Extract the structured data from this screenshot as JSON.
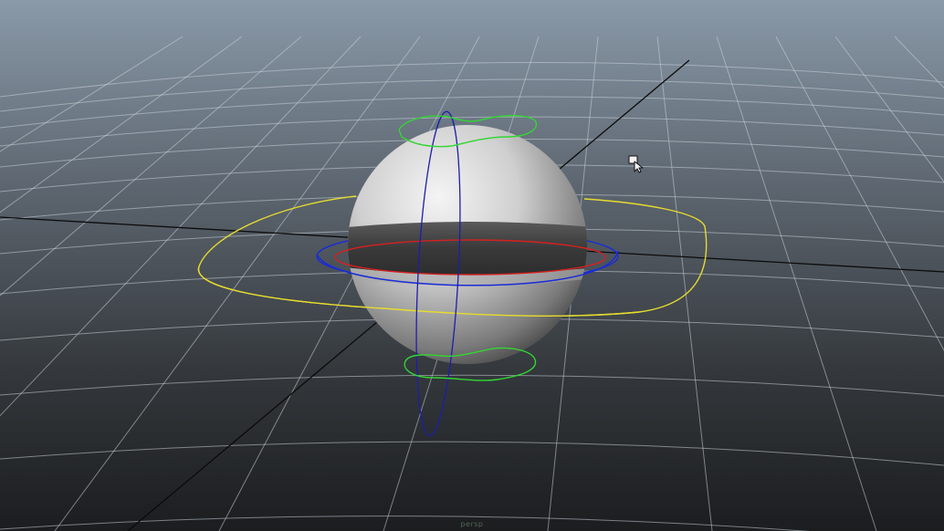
{
  "viewport": {
    "camera_name": "persp",
    "background_top": "#8a9aa9",
    "background_bottom": "#1b1d1f",
    "grid_color": "#c9d1d9",
    "axis_color": "#0b0b0b"
  },
  "scene": {
    "object": "sphere",
    "controls": {
      "translate_ring_color": "#e6dc2e",
      "rotate_x_color": "#1a2bd6",
      "rotate_y_color": "#d62020",
      "rotate_z_color": "#1d1ea8",
      "control_green_color": "#33d633"
    }
  },
  "cursor": {
    "icon": "select-cursor-icon"
  }
}
